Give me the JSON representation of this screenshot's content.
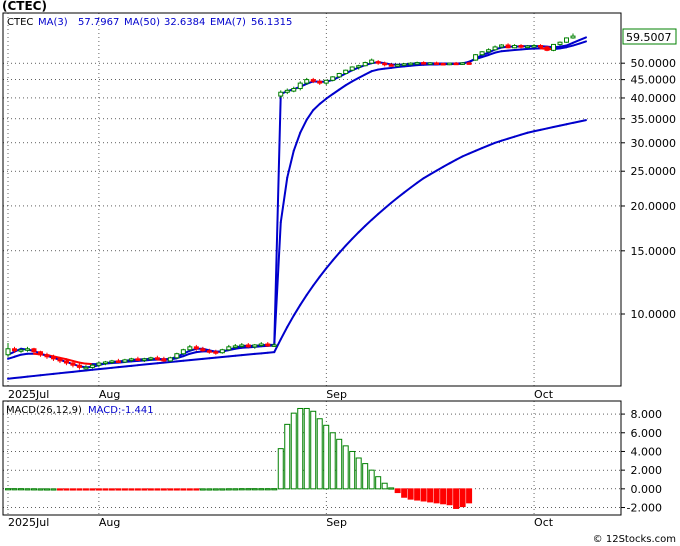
{
  "title": "(CTEC)",
  "copyright": "© 12Stocks.com",
  "colors": {
    "up_candle": "#008000",
    "down_candle": "#ff0000",
    "ma_line": "#0000cc",
    "ema_down": "#ff0000",
    "macd_pos": "#008000",
    "macd_neg": "#ff0000",
    "last_price_box": "#008000"
  },
  "chart_data": [
    {
      "type": "line",
      "panel": "price",
      "scale": "log",
      "ylim": [
        6.3,
        69
      ],
      "yticks": [
        10.0,
        15.0,
        20.0,
        25.0,
        30.0,
        35.0,
        40.0,
        45.0,
        50.0
      ],
      "ytick_labels": [
        "10.0000",
        "15.0000",
        "20.0000",
        "25.0000",
        "30.0000",
        "35.0000",
        "40.0000",
        "45.0000",
        "50.0000"
      ],
      "legend": [
        {
          "label": "CTEC"
        },
        {
          "label": "MA(3)",
          "value": "57.7967"
        },
        {
          "label": "MA(50)",
          "value": "32.6384"
        },
        {
          "label": "EMA(7)",
          "value": "56.1315"
        }
      ],
      "last_price_label": "59.5007",
      "last_price": 59.5,
      "x_tick_labels": [
        "2025Jul",
        "Aug",
        "Sep",
        "Oct"
      ],
      "x_tick_day_index": [
        0,
        14,
        49,
        81
      ],
      "candles": [
        [
          7.7,
          8.3,
          7.6,
          8.0
        ],
        [
          8.0,
          8.1,
          7.8,
          7.9
        ],
        [
          7.9,
          8.0,
          7.8,
          7.95
        ],
        [
          7.95,
          8.1,
          7.85,
          8.0
        ],
        [
          8.0,
          8.05,
          7.8,
          7.85
        ],
        [
          7.85,
          7.9,
          7.6,
          7.7
        ],
        [
          7.7,
          7.8,
          7.5,
          7.6
        ],
        [
          7.6,
          7.7,
          7.4,
          7.5
        ],
        [
          7.5,
          7.55,
          7.3,
          7.4
        ],
        [
          7.4,
          7.5,
          7.2,
          7.3
        ],
        [
          7.3,
          7.4,
          7.1,
          7.2
        ],
        [
          7.2,
          7.3,
          7.0,
          7.1
        ],
        [
          7.1,
          7.2,
          7.0,
          7.1
        ],
        [
          7.1,
          7.25,
          7.05,
          7.2
        ],
        [
          7.2,
          7.35,
          7.1,
          7.3
        ],
        [
          7.3,
          7.4,
          7.2,
          7.35
        ],
        [
          7.35,
          7.45,
          7.25,
          7.4
        ],
        [
          7.4,
          7.5,
          7.3,
          7.35
        ],
        [
          7.35,
          7.5,
          7.3,
          7.45
        ],
        [
          7.45,
          7.55,
          7.35,
          7.5
        ],
        [
          7.5,
          7.6,
          7.4,
          7.45
        ],
        [
          7.45,
          7.55,
          7.35,
          7.5
        ],
        [
          7.5,
          7.6,
          7.4,
          7.55
        ],
        [
          7.55,
          7.65,
          7.45,
          7.5
        ],
        [
          7.5,
          7.6,
          7.35,
          7.4
        ],
        [
          7.4,
          7.6,
          7.35,
          7.55
        ],
        [
          7.55,
          7.8,
          7.5,
          7.75
        ],
        [
          7.75,
          8.0,
          7.7,
          7.95
        ],
        [
          7.95,
          8.2,
          7.9,
          8.1
        ],
        [
          8.1,
          8.2,
          7.9,
          8.0
        ],
        [
          8.0,
          8.1,
          7.85,
          7.9
        ],
        [
          7.9,
          8.0,
          7.75,
          7.85
        ],
        [
          7.85,
          7.95,
          7.7,
          7.8
        ],
        [
          7.8,
          8.0,
          7.75,
          7.95
        ],
        [
          7.95,
          8.2,
          7.9,
          8.1
        ],
        [
          8.1,
          8.25,
          8.0,
          8.15
        ],
        [
          8.15,
          8.3,
          8.05,
          8.2
        ],
        [
          8.2,
          8.3,
          8.05,
          8.1
        ],
        [
          8.1,
          8.25,
          8.0,
          8.2
        ],
        [
          8.2,
          8.35,
          8.1,
          8.25
        ],
        [
          8.25,
          8.35,
          8.1,
          8.15
        ],
        [
          8.15,
          8.3,
          8.1,
          8.2
        ],
        [
          40.5,
          42.0,
          40.0,
          41.5
        ],
        [
          41.5,
          42.5,
          41.0,
          42.0
        ],
        [
          41.8,
          43.0,
          41.5,
          42.5
        ],
        [
          42.5,
          44.5,
          42.0,
          44.0
        ],
        [
          44.0,
          45.5,
          43.5,
          45.0
        ],
        [
          45.0,
          45.5,
          44.0,
          44.5
        ],
        [
          44.5,
          45.0,
          43.5,
          44.0
        ],
        [
          44.0,
          45.0,
          43.5,
          44.8
        ],
        [
          44.8,
          46.0,
          44.5,
          45.8
        ],
        [
          45.8,
          47.0,
          45.5,
          46.8
        ],
        [
          46.8,
          48.0,
          46.5,
          47.8
        ],
        [
          47.8,
          49.0,
          47.5,
          48.8
        ],
        [
          48.8,
          49.5,
          48.0,
          49.2
        ],
        [
          49.2,
          50.5,
          49.0,
          50.2
        ],
        [
          50.0,
          51.5,
          49.8,
          51.0
        ],
        [
          50.5,
          51.0,
          49.5,
          50.0
        ],
        [
          50.0,
          50.5,
          49.0,
          49.5
        ],
        [
          49.5,
          50.0,
          49.0,
          49.3
        ],
        [
          49.3,
          49.8,
          48.9,
          49.5
        ],
        [
          49.5,
          50.0,
          49.2,
          49.8
        ],
        [
          49.8,
          50.3,
          49.3,
          50.0
        ],
        [
          50.0,
          50.5,
          49.5,
          50.2
        ],
        [
          50.2,
          50.6,
          49.6,
          49.9
        ],
        [
          49.9,
          50.3,
          49.5,
          50.1
        ],
        [
          50.1,
          50.5,
          49.6,
          49.9
        ],
        [
          49.9,
          50.2,
          49.5,
          49.8
        ],
        [
          49.8,
          50.2,
          49.4,
          50.0
        ],
        [
          50.0,
          50.4,
          49.6,
          49.9
        ],
        [
          49.9,
          50.3,
          49.5,
          50.1
        ],
        [
          50.1,
          50.5,
          49.7,
          50.0
        ],
        [
          51.0,
          53.0,
          50.8,
          52.8
        ],
        [
          52.8,
          54.0,
          52.5,
          53.8
        ],
        [
          53.8,
          55.0,
          53.5,
          54.5
        ],
        [
          54.5,
          56.0,
          54.2,
          55.5
        ],
        [
          55.5,
          56.5,
          55.0,
          56.2
        ],
        [
          56.2,
          56.8,
          55.0,
          55.2
        ],
        [
          55.2,
          56.5,
          55.0,
          56.0
        ],
        [
          56.0,
          56.5,
          55.0,
          55.4
        ],
        [
          55.4,
          56.2,
          55.0,
          55.8
        ],
        [
          55.8,
          56.5,
          55.3,
          56.0
        ],
        [
          56.0,
          56.5,
          55.2,
          55.5
        ],
        [
          55.5,
          55.8,
          54.0,
          54.3
        ],
        [
          54.3,
          56.5,
          54.0,
          56.4
        ],
        [
          56.4,
          57.5,
          56.0,
          57.2
        ],
        [
          57.2,
          59.0,
          57.0,
          58.8
        ],
        [
          58.8,
          60.5,
          58.5,
          59.5
        ]
      ],
      "series": [
        {
          "name": "MA(3)",
          "style": "solid",
          "values": [
            7.7,
            7.85,
            8.0,
            7.95,
            7.9,
            7.75,
            7.65,
            7.55,
            7.45,
            7.35,
            7.25,
            7.15,
            7.1,
            7.12,
            7.2,
            7.28,
            7.35,
            7.38,
            7.4,
            7.45,
            7.47,
            7.48,
            7.5,
            7.5,
            7.48,
            7.5,
            7.6,
            7.75,
            7.9,
            8.0,
            8.0,
            7.92,
            7.85,
            7.85,
            7.95,
            8.05,
            8.15,
            8.15,
            8.15,
            8.18,
            8.2,
            8.2,
            41.0,
            41.8,
            42.3,
            43.0,
            43.8,
            44.5,
            44.4,
            44.4,
            44.9,
            45.8,
            46.8,
            47.8,
            48.6,
            49.4,
            50.0,
            50.3,
            50.0,
            49.6,
            49.5,
            49.6,
            49.8,
            50.0,
            50.0,
            50.0,
            49.9,
            49.9,
            49.9,
            49.9,
            50.0,
            50.4,
            51.5,
            52.7,
            53.5,
            54.6,
            55.3,
            55.6,
            55.6,
            55.7,
            55.8,
            55.8,
            55.8,
            55.6,
            55.4,
            55.6,
            56.0,
            57.0,
            58.0,
            59.0
          ]
        },
        {
          "name": "EMA(7)",
          "style": "solid",
          "values": [
            7.5,
            7.6,
            7.7,
            7.75,
            7.75,
            7.72,
            7.68,
            7.62,
            7.55,
            7.48,
            7.4,
            7.32,
            7.27,
            7.25,
            7.25,
            7.27,
            7.3,
            7.32,
            7.35,
            7.38,
            7.4,
            7.42,
            7.45,
            7.46,
            7.45,
            7.47,
            7.53,
            7.63,
            7.75,
            7.83,
            7.87,
            7.87,
            7.85,
            7.87,
            7.93,
            8.0,
            8.05,
            8.07,
            8.1,
            8.13,
            8.15,
            8.17,
            18.0,
            24.0,
            28.5,
            32.0,
            34.8,
            37.0,
            38.5,
            39.8,
            41.0,
            42.2,
            43.4,
            44.5,
            45.5,
            46.5,
            47.5,
            48.0,
            48.3,
            48.5,
            48.8,
            49.0,
            49.2,
            49.4,
            49.5,
            49.6,
            49.6,
            49.7,
            49.7,
            49.8,
            49.8,
            50.5,
            51.3,
            52.0,
            52.7,
            53.5,
            54.0,
            54.2,
            54.4,
            54.6,
            54.8,
            54.9,
            55.0,
            54.8,
            54.7,
            55.0,
            55.4,
            56.0,
            56.7,
            57.5
          ]
        },
        {
          "name": "MA(50)",
          "style": "solid",
          "values": [
            6.6,
            6.63,
            6.66,
            6.69,
            6.72,
            6.75,
            6.78,
            6.81,
            6.84,
            6.87,
            6.9,
            6.93,
            6.96,
            6.99,
            7.02,
            7.05,
            7.08,
            7.11,
            7.14,
            7.17,
            7.2,
            7.23,
            7.26,
            7.29,
            7.32,
            7.35,
            7.38,
            7.41,
            7.44,
            7.47,
            7.5,
            7.53,
            7.56,
            7.59,
            7.62,
            7.65,
            7.68,
            7.71,
            7.74,
            7.77,
            7.8,
            7.83,
            8.5,
            9.2,
            9.9,
            10.6,
            11.3,
            12.0,
            12.7,
            13.4,
            14.1,
            14.8,
            15.5,
            16.2,
            16.9,
            17.6,
            18.3,
            19.0,
            19.7,
            20.4,
            21.1,
            21.8,
            22.5,
            23.2,
            23.9,
            24.5,
            25.1,
            25.7,
            26.3,
            26.9,
            27.5,
            28.0,
            28.5,
            29.0,
            29.5,
            30.0,
            30.4,
            30.8,
            31.2,
            31.6,
            32.0,
            32.3,
            32.6,
            32.9,
            33.2,
            33.5,
            33.8,
            34.1,
            34.4,
            34.7
          ]
        }
      ]
    },
    {
      "type": "bar",
      "panel": "macd",
      "title_label": "MACD(26,12,9)",
      "value_label": "MACD:-1.441",
      "ylim": [
        -2.8,
        9.4
      ],
      "yticks": [
        -2.0,
        0.0,
        2.0,
        4.0,
        6.0,
        8.0
      ],
      "ytick_labels": [
        "-2.000",
        "0.000",
        "2.000",
        "4.000",
        "6.000",
        "8.000"
      ],
      "x_tick_labels": [
        "2025Jul",
        "Aug",
        "Sep",
        "Oct"
      ],
      "values": [
        0.02,
        0.02,
        0.02,
        0.01,
        0.01,
        0.0,
        0.0,
        0.0,
        -0.03,
        -0.05,
        -0.07,
        -0.08,
        -0.09,
        -0.1,
        -0.1,
        -0.1,
        -0.1,
        -0.1,
        -0.09,
        -0.09,
        -0.08,
        -0.08,
        -0.07,
        -0.07,
        -0.06,
        -0.05,
        -0.04,
        -0.03,
        -0.02,
        -0.01,
        0.0,
        0.0,
        0.0,
        0.0,
        0.01,
        0.01,
        0.02,
        0.02,
        0.02,
        0.02,
        0.02,
        0.02,
        4.3,
        6.9,
        8.1,
        8.6,
        8.6,
        8.3,
        7.5,
        6.8,
        6.0,
        5.3,
        4.6,
        4.0,
        3.3,
        2.7,
        2.0,
        1.3,
        0.6,
        0.1,
        -0.4,
        -0.9,
        -1.1,
        -1.2,
        -1.3,
        -1.4,
        -1.5,
        -1.6,
        -1.7,
        -2.1,
        -1.9,
        -1.5
      ]
    }
  ]
}
